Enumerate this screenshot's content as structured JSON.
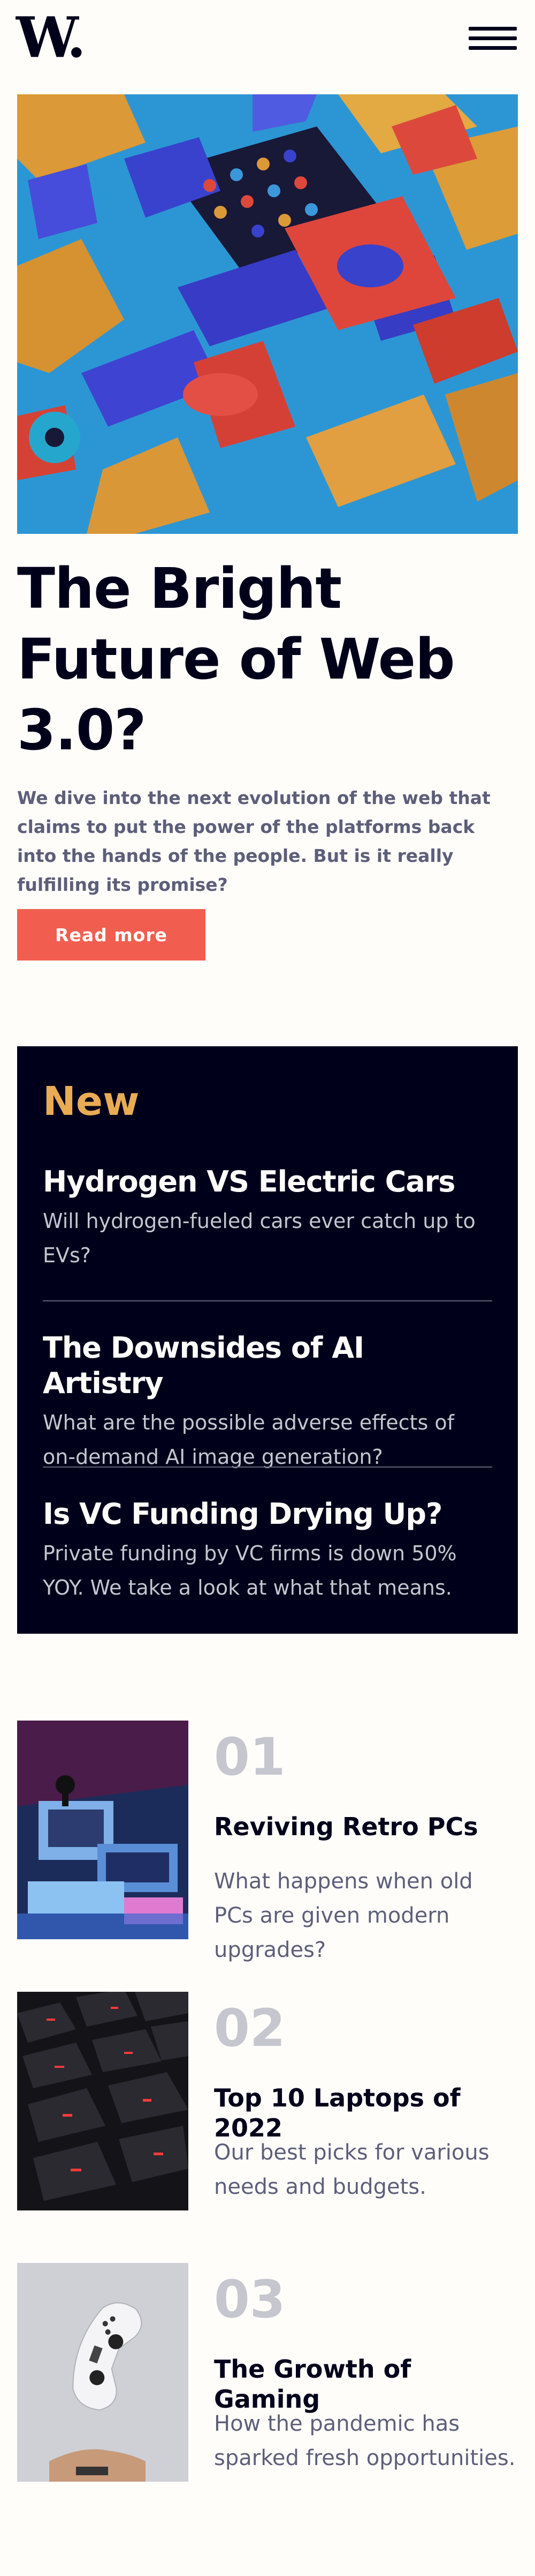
{
  "header": {
    "logo": "W.",
    "menu_icon": "hamburger-menu-icon"
  },
  "hero": {
    "image": "abstract-3d-blocks-image",
    "title": "The Bright Future of Web 3.0?",
    "description": "We dive into the next evolution of the web that claims to put the power of the platforms back into the hands of the people. But is it really fulfilling its promise?",
    "button_label": "Read more"
  },
  "new_section": {
    "heading": "New",
    "items": [
      {
        "title": "Hydrogen VS Electric Cars",
        "description": "Will hydrogen-fueled cars ever catch up to EVs?"
      },
      {
        "title": "The Downsides of AI Artistry",
        "description": "What are the possible adverse effects of on-demand AI image generation?"
      },
      {
        "title": "Is VC Funding Drying Up?",
        "description": "Private funding by VC firms is down 50% YOY. We take a look at what that means."
      }
    ]
  },
  "articles": [
    {
      "number": "01",
      "title": "Reviving Retro PCs",
      "description": "What happens when old PCs are given modern upgrades?",
      "image": "retro-pcs-image"
    },
    {
      "number": "02",
      "title": "Top 10 Laptops of 2022",
      "description": "Our best picks for various needs and budgets.",
      "image": "laptop-keyboard-image"
    },
    {
      "number": "03",
      "title": "The Growth of Gaming",
      "description": "How the pandemic has sparked fresh opportunities.",
      "image": "game-controller-image"
    }
  ],
  "colors": {
    "background": "#fffdfa",
    "dark_navy": "#00001a",
    "accent_red": "#f15e50",
    "accent_orange": "#e9ab53",
    "grayish_blue": "#5d5f79",
    "light_gray": "#c5c6ce"
  }
}
